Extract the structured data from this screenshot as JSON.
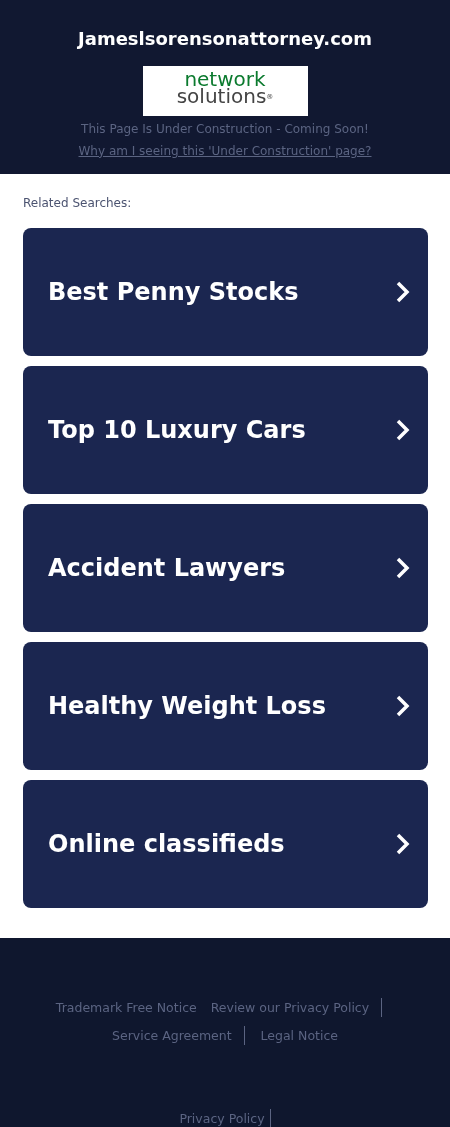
{
  "header": {
    "domain": "Jameslsorensonattorney.com",
    "logo": {
      "line_1": "network",
      "line_2": "solutions",
      "mark": "®"
    },
    "notice": "This Page Is Under Construction - Coming Soon!",
    "notice_link": "Why am I seeing this 'Under Construction' page?"
  },
  "related": {
    "heading": "Related Searches:",
    "items": [
      {
        "label": "Best Penny Stocks"
      },
      {
        "label": "Top 10 Luxury Cars"
      },
      {
        "label": "Accident Lawyers"
      },
      {
        "label": "Healthy Weight Loss"
      },
      {
        "label": "Online classifieds"
      }
    ]
  },
  "footer": {
    "links": [
      {
        "label": "Trademark Free Notice",
        "divider_after": false
      },
      {
        "label": "Review our Privacy Policy",
        "divider_after": true
      },
      {
        "label": "Service Agreement",
        "divider_after": true
      },
      {
        "label": "Legal Notice",
        "divider_after": false
      }
    ],
    "bottom_links": [
      {
        "label": "Privacy Policy",
        "divider_after": true
      }
    ]
  }
}
